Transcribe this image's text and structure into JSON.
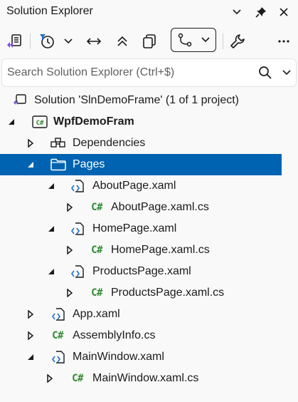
{
  "window": {
    "title": "Solution Explorer"
  },
  "search": {
    "placeholder": "Search Solution Explorer (Ctrl+$)"
  },
  "tree": {
    "solution": "Solution 'SlnDemoFrame' (1 of 1 project)",
    "project": "WpfDemoFram",
    "dependencies": "Dependencies",
    "pages_folder": "Pages",
    "about_page": "AboutPage.xaml",
    "about_page_cs": "AboutPage.xaml.cs",
    "home_page": "HomePage.xaml",
    "home_page_cs": "HomePage.xaml.cs",
    "products_page": "ProductsPage.xaml",
    "products_page_cs": "ProductsPage.xaml.cs",
    "app_xaml": "App.xaml",
    "assembly_info": "AssemblyInfo.cs",
    "main_window": "MainWindow.xaml",
    "main_window_cs": "MainWindow.xaml.cs",
    "cs_badge": "C#"
  },
  "colors": {
    "selection": "#0063b1",
    "csharp_badge": "#2e8b2e",
    "accent_purple": "#7a4bd6"
  }
}
